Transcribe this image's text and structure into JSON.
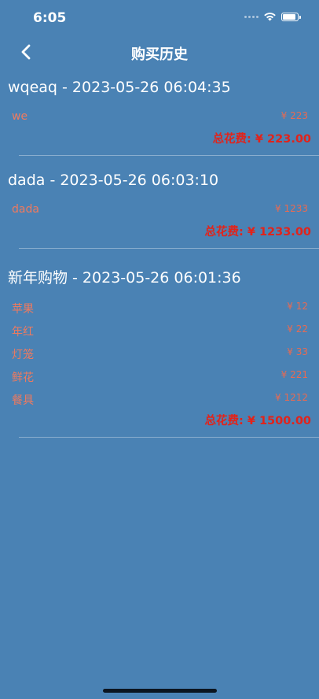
{
  "status_bar": {
    "time": "6:05"
  },
  "nav": {
    "title": "购买历史",
    "back_icon": "chevron-left-icon"
  },
  "orders": [
    {
      "header": "wqeaq - 2023-05-26 06:04:35",
      "items": [
        {
          "name": "we",
          "price": "¥ 223"
        }
      ],
      "total": "总花费: ¥ 223.00"
    },
    {
      "header": "dada - 2023-05-26 06:03:10",
      "items": [
        {
          "name": "dada",
          "price": "¥ 1233"
        }
      ],
      "total": "总花费: ¥ 1233.00"
    },
    {
      "header": "新年购物 - 2023-05-26 06:01:36",
      "items": [
        {
          "name": "苹果",
          "price": "¥ 12"
        },
        {
          "name": "年红",
          "price": "¥ 22"
        },
        {
          "name": "灯笼",
          "price": "¥ 33"
        },
        {
          "name": "鲜花",
          "price": "¥ 221"
        },
        {
          "name": "餐具",
          "price": "¥ 1212"
        }
      ],
      "total": "总花费: ¥ 1500.00"
    }
  ],
  "colors": {
    "background": "#4a82b4",
    "item_text": "#f07a5e",
    "total_text": "#e2231a"
  }
}
